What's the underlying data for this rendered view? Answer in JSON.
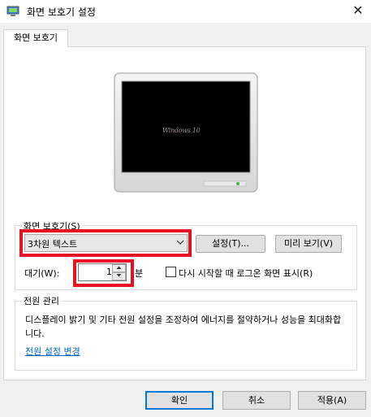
{
  "window": {
    "title": "화면 보호기 설정",
    "close_glyph": "✕"
  },
  "tabs": [
    {
      "label": "화면 보호기"
    }
  ],
  "preview": {
    "screen_text": "Windows 10"
  },
  "screensaver_group": {
    "label": "화면 보호기(S)",
    "selected": "3차원 텍스트",
    "settings_button": "설정(T)...",
    "preview_button": "미리 보기(V)",
    "wait_label": "대기(W):",
    "wait_value": "1",
    "minutes_label": "분",
    "logon_checkbox_label": "다시 시작할 때 로그온 화면 표시(R)",
    "logon_checked": false
  },
  "power_group": {
    "label": "전원 관리",
    "description": "디스플레이 밝기 및 기타 전원 설정을 조정하여 에너지를 절약하거나 성능을 최대화합니다.",
    "link": "전원 설정 변경"
  },
  "buttons": {
    "ok": "확인",
    "cancel": "취소",
    "apply": "적용(A)"
  },
  "colors": {
    "highlight": "#e81123",
    "link": "#0066cc",
    "default_button_border": "#0078d7"
  }
}
